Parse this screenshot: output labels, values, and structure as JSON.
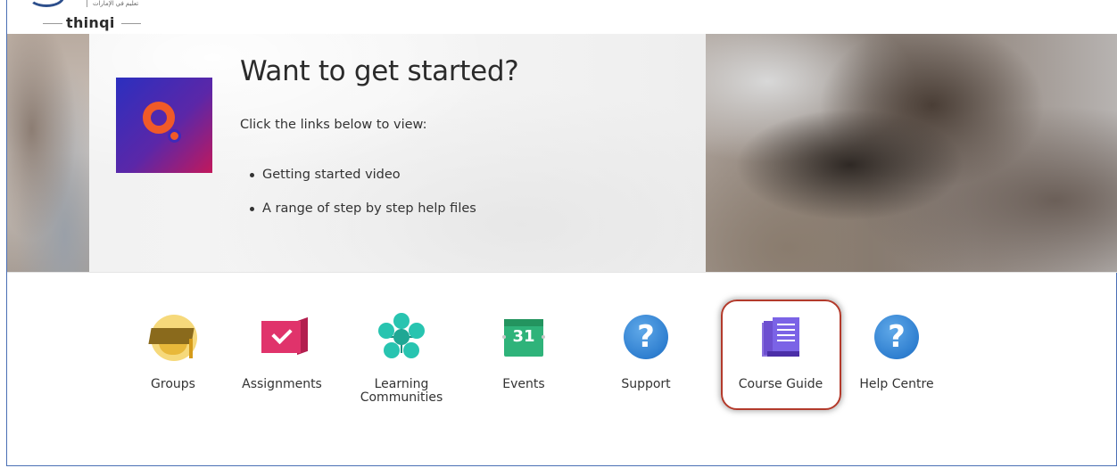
{
  "header": {
    "logo_text": "thinqi",
    "logo_subtext": "تعليم في الإمارات"
  },
  "banner": {
    "title": "Want to get started?",
    "subtitle": "Click the links below to view:",
    "items": [
      "Getting started video",
      "A range of step by step help files"
    ]
  },
  "tiles": [
    {
      "label": "Groups",
      "icon": "graduation-cap-icon"
    },
    {
      "label": "Assignments",
      "icon": "checkmark-flag-icon"
    },
    {
      "label": "Learning\nCommunities",
      "icon": "network-icon"
    },
    {
      "label": "Events",
      "icon": "calendar-icon",
      "icon_text": "31"
    },
    {
      "label": "Support",
      "icon": "question-icon",
      "icon_text": "?"
    },
    {
      "label": "Course Guide",
      "icon": "book-icon",
      "highlighted": true
    },
    {
      "label": "Help Centre",
      "icon": "question-icon",
      "icon_text": "?"
    }
  ],
  "colors": {
    "highlight_border": "#b33a2b",
    "brand_orange": "#f05a28",
    "help_blue": "#2f7fd0",
    "events_green": "#2fb37a"
  }
}
